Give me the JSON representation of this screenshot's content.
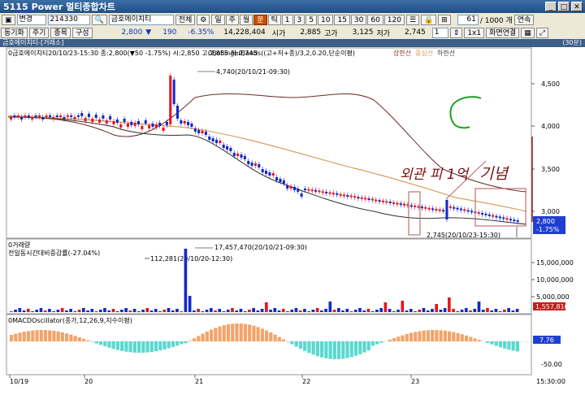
{
  "window": {
    "code": "5115",
    "title": "Power 멀티종합차트"
  },
  "toolbar1": {
    "type_select": "변경",
    "code_input": "214330",
    "stock_name": "금호에이치티",
    "all_button": "전체",
    "periods": [
      "일",
      "주",
      "월",
      "분",
      "틱",
      "1",
      "3",
      "5",
      "10",
      "15",
      "30",
      "60",
      "120"
    ],
    "active_period": "분",
    "count_value": "61",
    "count_total": "/ 1000 개",
    "continuous_button": "연속"
  },
  "toolbar2": {
    "sync_button": "동기화",
    "period_button": "주기",
    "item_button": "종목",
    "layout_button": "구성",
    "price": "2,800",
    "change_arrow": "▼",
    "change": "190",
    "change_rate": "-6.35%",
    "volume": "14,228,404",
    "open_label": "시가",
    "open": "2,885",
    "high_label": "고가",
    "high": "3,125",
    "low_label": "저가",
    "low": "2,745",
    "spin_value": "1",
    "ratio_button": "1x1",
    "link_button": "화면연결"
  },
  "chart": {
    "header": "금호에이치티-[거래소]",
    "period_badge": "(30분)",
    "price_panel": {
      "legend_stock": "0금호에이치티20/10/23-15:30 종:2,800(▼50  -1.75%) 시:2,850 고:2,855 저:2,745",
      "legend_bb": "0BollingerBands((고+저+종)/3,2,0.20,단순이평)",
      "legend_upper": "상한선",
      "legend_mid": "중심선",
      "legend_lower": "하한선",
      "high_annotation": "4,740(20/10/21-09:30)",
      "low_annotation": "2,745(20/10/23-15:30)",
      "y_ticks": [
        "4,500",
        "4,000",
        "3,500",
        "3,000"
      ],
      "current_price": "2,800",
      "current_change": "-1.75%",
      "handwriting_1": "외관 피 1억",
      "handwriting_2": "기념"
    },
    "volume_panel": {
      "legend_vol": "0거래량",
      "legend_pct": "전일동시간대비증감률(-27.04%)",
      "peak_annotation": "17,457,470(20/10/21-09:30)",
      "prev_annotation": "112,281(20/10/20-12:30)",
      "y_ticks": [
        "15,000,000",
        "10,000,000",
        "5,000,000"
      ],
      "current_volume": "1,557,810"
    },
    "macd_panel": {
      "legend": "0MACDOscillator(종가,12,26,9,지수이평)",
      "y_ticks": [
        "-50.00"
      ],
      "current_value": "7.76"
    },
    "x_labels": [
      "10/19",
      "20",
      "21",
      "22",
      "23"
    ],
    "time_label": "15:30:00"
  },
  "colors": {
    "up": "#e8141e",
    "down": "#1428c8",
    "macd": "#5ad8d0",
    "macd_pos": "#f2a46a",
    "ma": "#d8a060",
    "band": "#5a2a2a"
  }
}
